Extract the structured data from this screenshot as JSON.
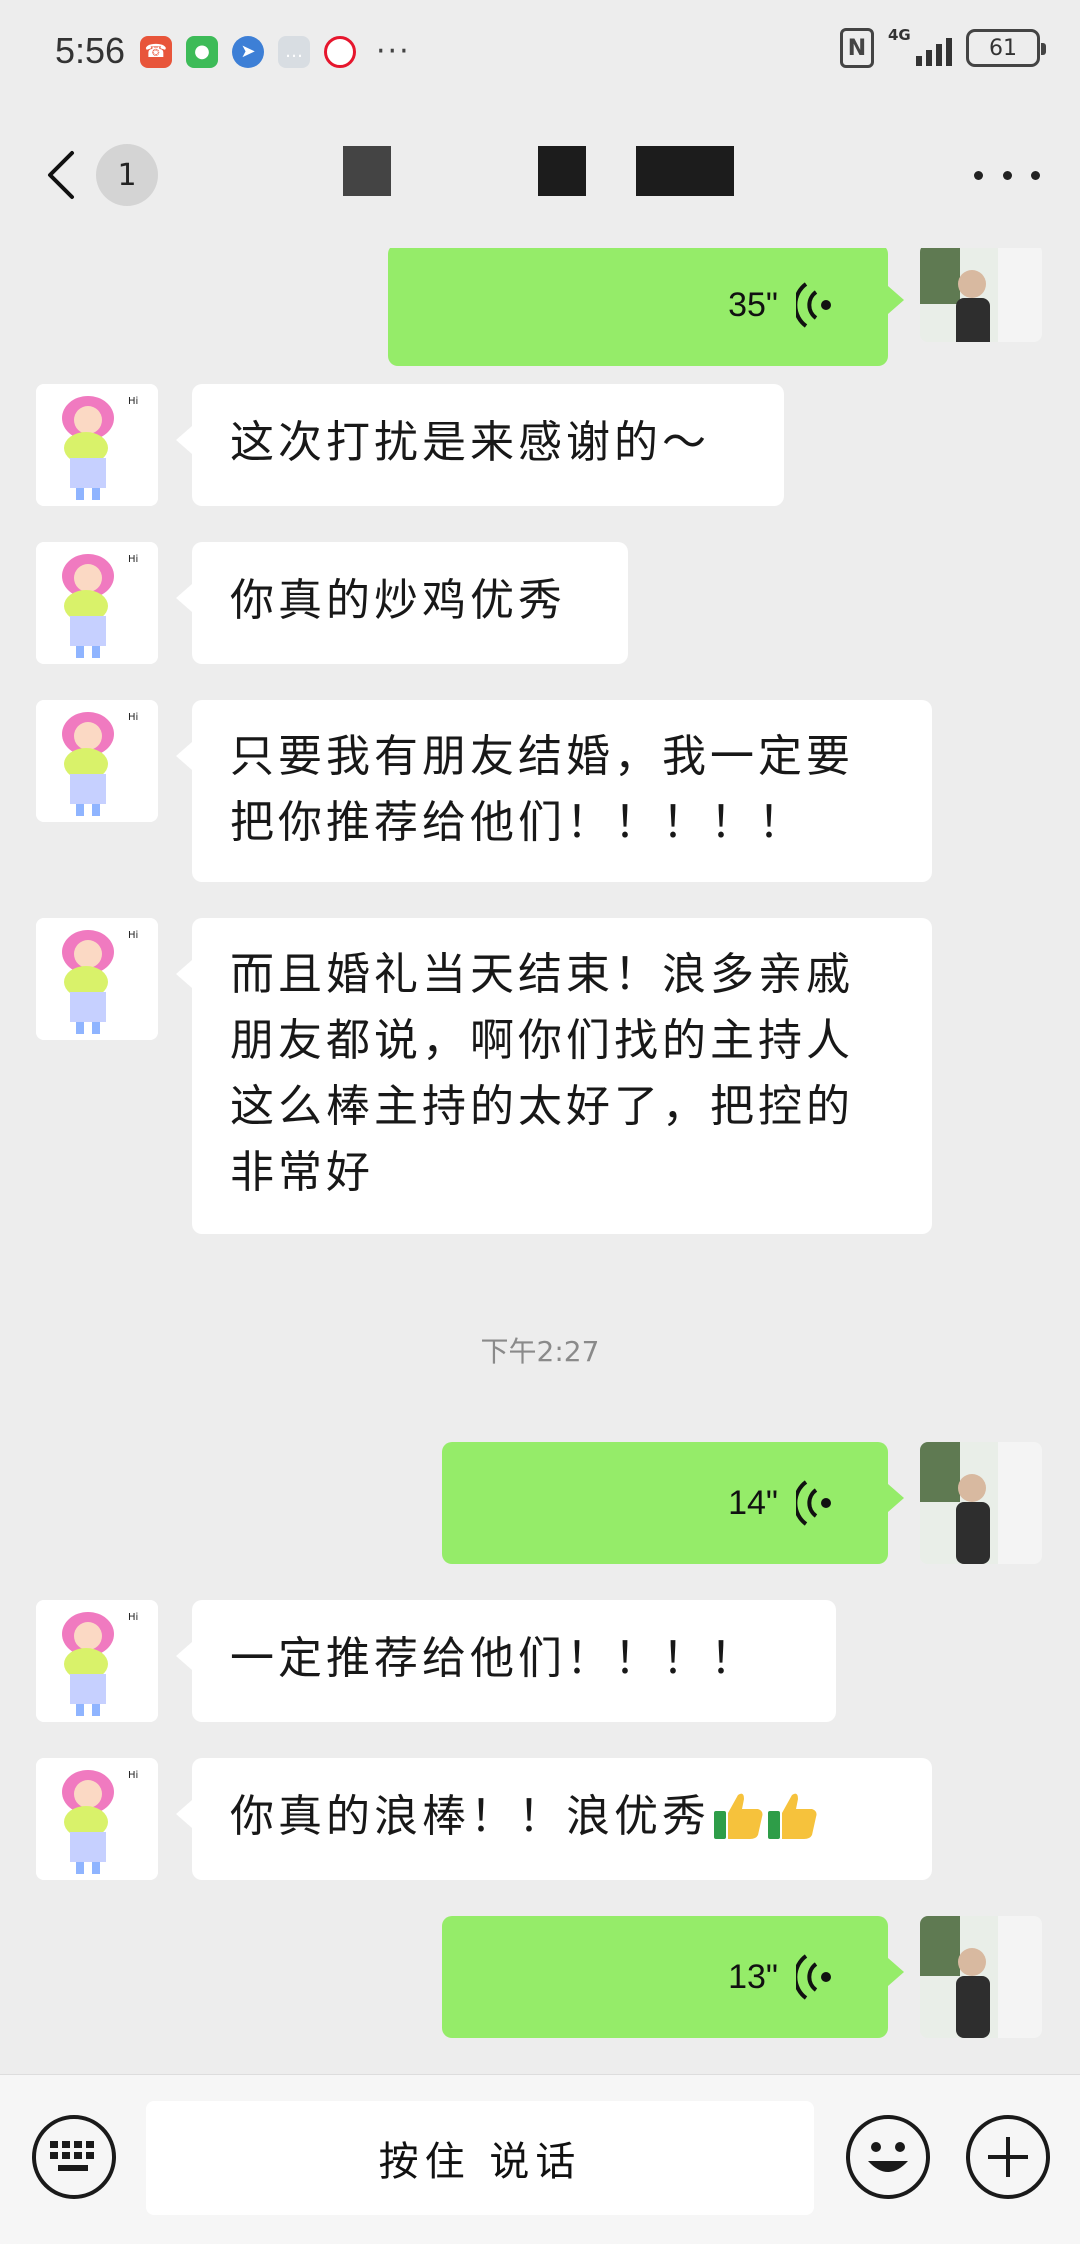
{
  "status_bar": {
    "time": "5:56",
    "more": "···",
    "network": "4G",
    "battery": "61"
  },
  "nav": {
    "unread_count": "1"
  },
  "messages": [
    {
      "type": "voice",
      "side": "out",
      "duration": "35\""
    },
    {
      "type": "text",
      "side": "in",
      "lines": [
        "这次打扰是来感谢的～"
      ]
    },
    {
      "type": "text",
      "side": "in",
      "lines": [
        "你真的炒鸡优秀"
      ]
    },
    {
      "type": "text",
      "side": "in",
      "lines": [
        "只要我有朋友结婚，我一定要",
        "把你推荐给他们！！！！！"
      ]
    },
    {
      "type": "text",
      "side": "in",
      "lines": [
        "而且婚礼当天结束！浪多亲戚",
        "朋友都说，啊你们找的主持人",
        "这么棒主持的太好了，把控的",
        "非常好"
      ]
    },
    {
      "type": "time",
      "text": "下午2:27"
    },
    {
      "type": "voice",
      "side": "out",
      "duration": "14\""
    },
    {
      "type": "text",
      "side": "in",
      "lines": [
        "一定推荐给他们！！！！"
      ]
    },
    {
      "type": "text",
      "side": "in",
      "lines": [
        "你真的浪棒！！浪优秀"
      ],
      "emoji": "thumbs-up-icon"
    },
    {
      "type": "voice",
      "side": "out",
      "duration": "13\""
    }
  ],
  "input": {
    "hold_to_talk": "按住 说话"
  },
  "colors": {
    "background": "#ededed",
    "out_bubble": "#95ec69",
    "in_bubble": "#ffffff"
  }
}
